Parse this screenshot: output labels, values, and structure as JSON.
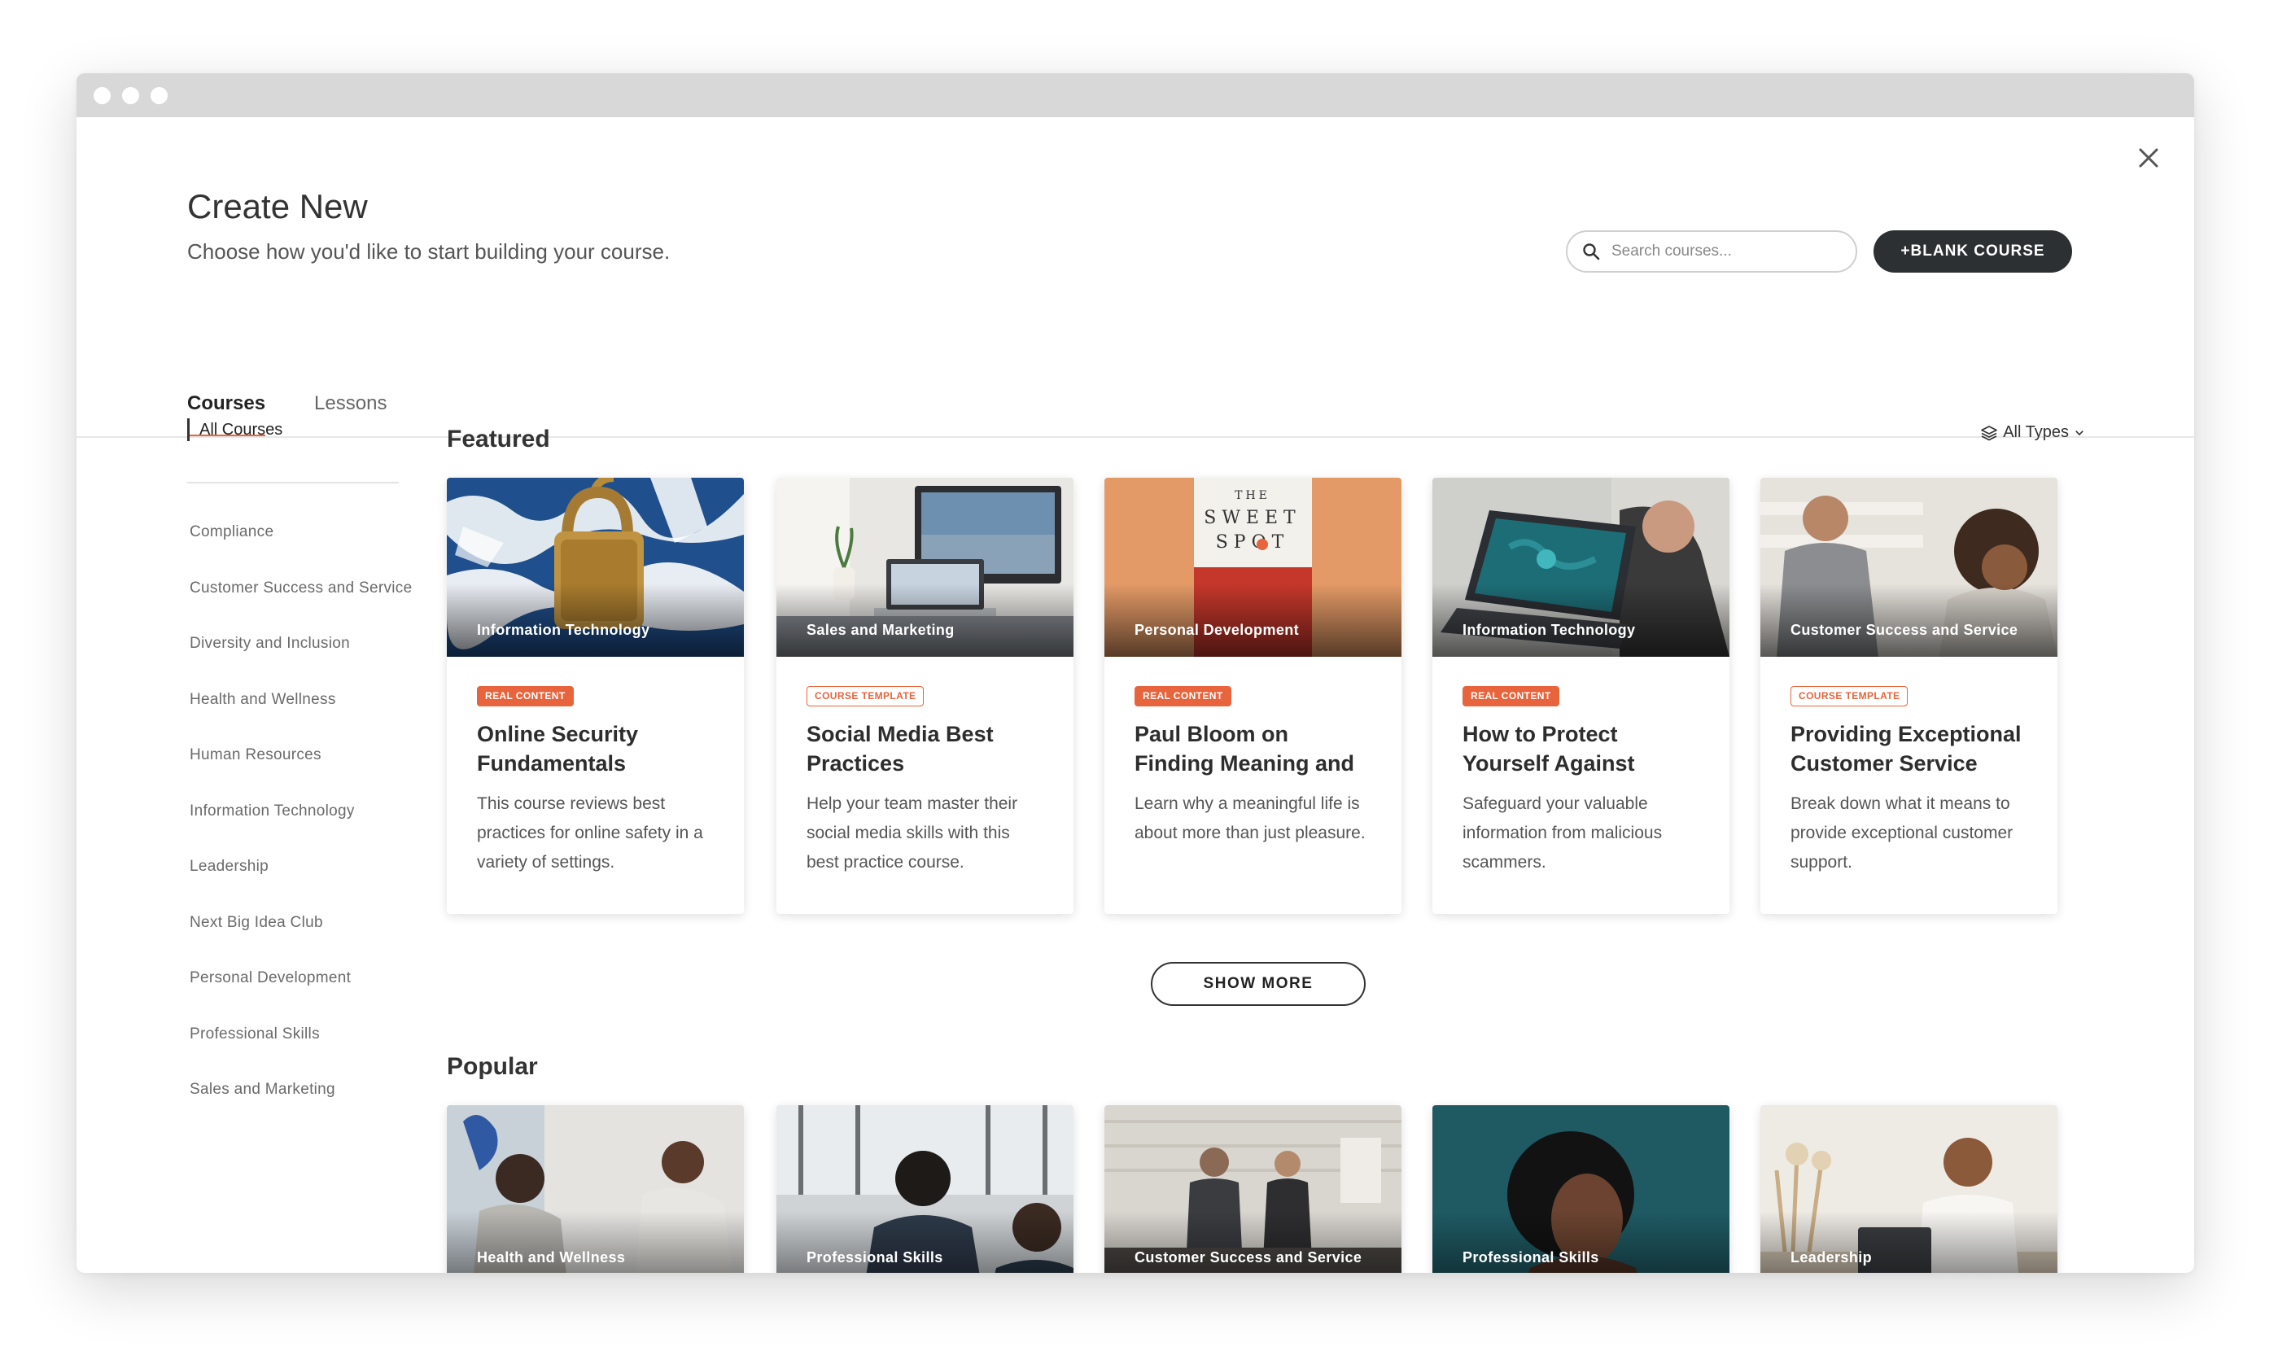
{
  "page": {
    "title": "Create New",
    "subtitle": "Choose how you'd like to start building your course."
  },
  "search": {
    "placeholder": "Search courses..."
  },
  "blank_course_label": "+BLANK COURSE",
  "tabs": [
    {
      "label": "Courses",
      "active": true
    },
    {
      "label": "Lessons",
      "active": false
    }
  ],
  "sidebar": {
    "all_label": "All Courses",
    "items": [
      "Compliance",
      "Customer Success and Service",
      "Diversity and Inclusion",
      "Health and Wellness",
      "Human Resources",
      "Information Technology",
      "Leadership",
      "Next Big Idea Club",
      "Personal Development",
      "Professional Skills",
      "Sales and Marketing"
    ]
  },
  "featured": {
    "title": "Featured",
    "filter_label": "All Types",
    "cards": [
      {
        "category": "Information Technology",
        "badge": "REAL CONTENT",
        "title": "Online Security Fundamentals",
        "description": "This course reviews best practices for online safety in a variety of settings."
      },
      {
        "category": "Sales and Marketing",
        "badge": "COURSE TEMPLATE",
        "title": "Social Media Best Practices",
        "description": "Help your team master their social media skills with this best practice course."
      },
      {
        "category": "Personal Development",
        "badge": "REAL CONTENT",
        "title": "Paul Bloom on Finding Meaning and Pleasure ...",
        "description": "Learn why a meaningful life is about more than just pleasure."
      },
      {
        "category": "Information Technology",
        "badge": "REAL CONTENT",
        "title": "How to Protect Yourself Against Phishing Atta...",
        "description": "Safeguard your valuable information from malicious scammers."
      },
      {
        "category": "Customer Success and Service",
        "badge": "COURSE TEMPLATE",
        "title": "Providing Exceptional Customer Service",
        "description": "Break down what it means to provide exceptional customer support."
      }
    ],
    "show_more_label": "SHOW MORE"
  },
  "popular": {
    "title": "Popular",
    "cards": [
      {
        "category": "Health and Wellness"
      },
      {
        "category": "Professional Skills"
      },
      {
        "category": "Customer Success and Service"
      },
      {
        "category": "Professional Skills"
      },
      {
        "category": "Leadership"
      }
    ]
  },
  "book_cover": {
    "line1": "THE",
    "line2": "SWEET",
    "line3": "SPOT"
  },
  "colors": {
    "accent": "#e8643c",
    "dark_button": "#2d3033",
    "titlebar": "#d8d8d8"
  },
  "icons": {
    "close": "close-icon",
    "search": "search-icon",
    "filter": "layers-icon",
    "dropdown": "chevron-down-icon"
  }
}
